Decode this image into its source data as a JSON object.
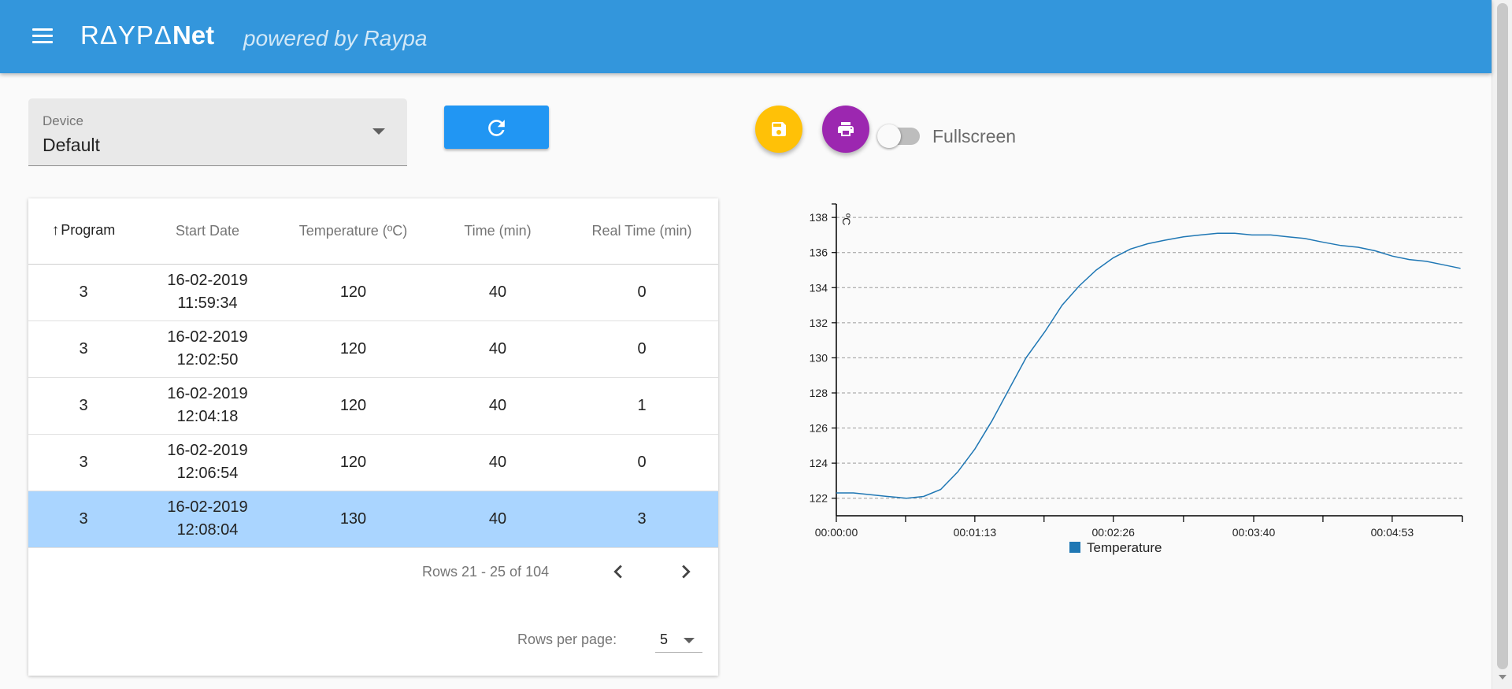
{
  "header": {
    "brand_main": "RΔYPΔ",
    "brand_net": "Net",
    "tagline": "powered by Raypa"
  },
  "device": {
    "label": "Device",
    "value": "Default"
  },
  "actions": {
    "refresh_icon": "refresh-icon",
    "save_icon": "floppy-disk-icon",
    "print_icon": "printer-icon",
    "fullscreen_label": "Fullscreen",
    "fullscreen_on": false
  },
  "colors": {
    "appbar": "#3396dc",
    "refresh": "#2196f3",
    "save": "#ffc107",
    "print": "#9c27b0",
    "selected_row": "#aad5ff",
    "series": "#1f77b4"
  },
  "table": {
    "columns": [
      "Program",
      "Start Date",
      "Temperature (ºC)",
      "Time (min)",
      "Real Time (min)"
    ],
    "sort_column": "Program",
    "rows": [
      {
        "program": "3",
        "date": "16-02-2019",
        "time_of_day": "11:59:34",
        "temperature": "120",
        "time_min": "40",
        "real_time_min": "0",
        "selected": false
      },
      {
        "program": "3",
        "date": "16-02-2019",
        "time_of_day": "12:02:50",
        "temperature": "120",
        "time_min": "40",
        "real_time_min": "0",
        "selected": false
      },
      {
        "program": "3",
        "date": "16-02-2019",
        "time_of_day": "12:04:18",
        "temperature": "120",
        "time_min": "40",
        "real_time_min": "1",
        "selected": false
      },
      {
        "program": "3",
        "date": "16-02-2019",
        "time_of_day": "12:06:54",
        "temperature": "120",
        "time_min": "40",
        "real_time_min": "0",
        "selected": false
      },
      {
        "program": "3",
        "date": "16-02-2019",
        "time_of_day": "12:08:04",
        "temperature": "130",
        "time_min": "40",
        "real_time_min": "3",
        "selected": true
      }
    ],
    "pagination": {
      "range_label": "Rows 21 - 25 of 104",
      "rows_per_page_label": "Rows per page:",
      "rows_per_page": "5"
    }
  },
  "chart_data": {
    "type": "line",
    "ylabel": "ºC",
    "ylim": [
      121,
      138.5
    ],
    "yticks": [
      122,
      124,
      126,
      128,
      130,
      132,
      134,
      136,
      138
    ],
    "xlim": [
      0,
      330
    ],
    "xticks": [
      0,
      73,
      146,
      220,
      293
    ],
    "xtick_labels": [
      "00:00:00",
      "00:01:13",
      "00:02:26",
      "00:03:40",
      "00:04:53"
    ],
    "x_minor_ticks": [
      36.5,
      109.5,
      183,
      256.5,
      330
    ],
    "grid": "horizontal-dashed",
    "legend_position": "bottom-center",
    "series": [
      {
        "name": "Temperature",
        "x": [
          0,
          9,
          18,
          27,
          37,
          46,
          55,
          64,
          73,
          82,
          91,
          100,
          110,
          119,
          128,
          137,
          146,
          155,
          164,
          173,
          183,
          192,
          201,
          210,
          219,
          229,
          238,
          247,
          256,
          266,
          275,
          284,
          293,
          302,
          311,
          320,
          329
        ],
        "y": [
          122.3,
          122.3,
          122.2,
          122.1,
          122.0,
          122.1,
          122.5,
          123.5,
          124.8,
          126.4,
          128.2,
          130.0,
          131.5,
          133.0,
          134.1,
          135.0,
          135.7,
          136.2,
          136.5,
          136.7,
          136.9,
          137.0,
          137.1,
          137.1,
          137.0,
          137.0,
          136.9,
          136.8,
          136.6,
          136.4,
          136.3,
          136.1,
          135.8,
          135.6,
          135.5,
          135.3,
          135.1
        ]
      }
    ]
  }
}
